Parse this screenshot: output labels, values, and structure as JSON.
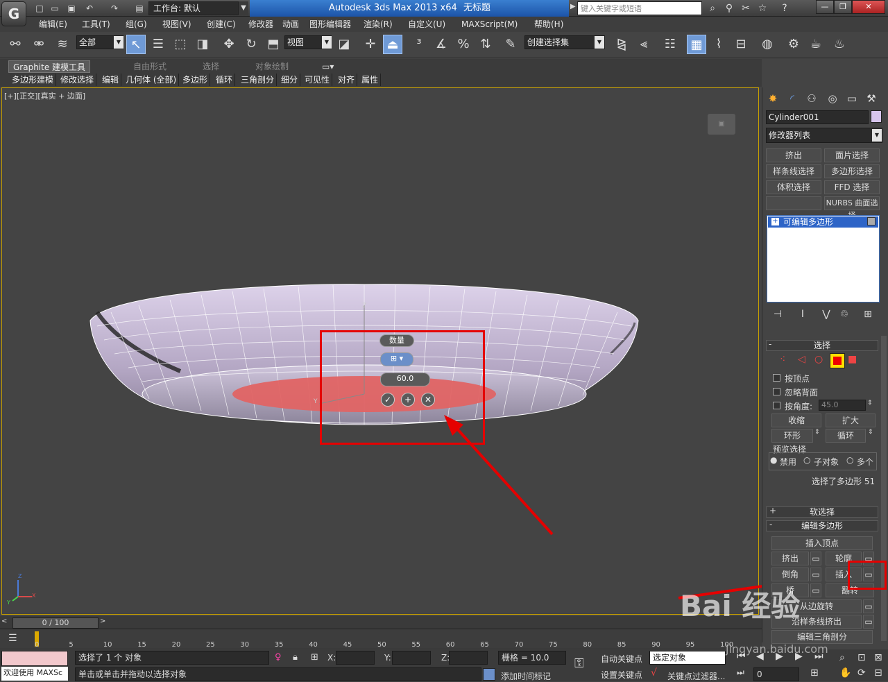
{
  "titlebar": {
    "workspace_label": "工作台: 默认",
    "app_name": "Autodesk 3ds Max  2013 x64",
    "doc_title": "无标题",
    "search_placeholder": "键入关键字或短语"
  },
  "menus": [
    "编辑(E)",
    "工具(T)",
    "组(G)",
    "视图(V)",
    "创建(C)",
    "修改器",
    "动画",
    "图形编辑器",
    "渲染(R)",
    "自定义(U)",
    "MAXScript(M)",
    "帮助(H)"
  ],
  "toolbar": {
    "filter_value": "全部",
    "refcoord_value": "视图",
    "selset_value": "创建选择集"
  },
  "ribbon": {
    "tabs": [
      "Graphite 建模工具",
      "自由形式",
      "选择",
      "对象绘制"
    ],
    "items": [
      "多边形建模",
      "修改选择",
      "编辑",
      "几何体 (全部)",
      "多边形",
      "循环",
      "三角剖分",
      "细分",
      "可见性",
      "对齐",
      "属性"
    ]
  },
  "viewport": {
    "label": "[+][正交][真实 + 边面]",
    "caddy": {
      "title": "数量",
      "value": "60.0"
    },
    "axis": {
      "x": "X",
      "y": "Y",
      "z": "Z"
    }
  },
  "command_panel": {
    "object_name": "Cylinder001",
    "modifier_list": "修改器列表",
    "modifier_buttons": [
      "挤出",
      "面片选择",
      "样条线选择",
      "多边形选择",
      "体积选择",
      "FFD 选择",
      "",
      "NURBS 曲面选择"
    ],
    "stack_item": "可编辑多边形",
    "selection": {
      "title": "选择",
      "by_vertex": "按顶点",
      "ignore_backfacing": "忽略背面",
      "by_angle": "按角度:",
      "angle_value": "45.0",
      "shrink": "收缩",
      "grow": "扩大",
      "ring": "环形",
      "loop": "循环",
      "preview_title": "预览选择",
      "preview_options": [
        "禁用",
        "子对象",
        "多个"
      ],
      "status": "选择了多边形 51"
    },
    "soft_selection": "软选择",
    "edit_polygons": {
      "title": "编辑多边形",
      "insert_vertex": "插入顶点",
      "extrude": "挤出",
      "outline": "轮廓",
      "bevel": "倒角",
      "inset": "插入",
      "bridge": "桥",
      "flip": "翻转",
      "hinge": "从边旋转",
      "extrude_spline": "沿样条线挤出",
      "retriangulate": "编辑三角剖分"
    }
  },
  "timeline": {
    "frame_slider": "0 / 100",
    "ticks": [
      "0",
      "5",
      "10",
      "15",
      "20",
      "25",
      "30",
      "35",
      "40",
      "45",
      "50",
      "55",
      "60",
      "65",
      "70",
      "75",
      "80",
      "85",
      "90",
      "95",
      "100"
    ]
  },
  "statusbar": {
    "script_label": "欢迎使用 MAXSc",
    "selected_status": "选择了 1 个 对象",
    "prompt": "单击或单击并拖动以选择对象",
    "x_label": "X:",
    "y_label": "Y:",
    "z_label": "Z:",
    "grid": "栅格 = 10.0",
    "add_time_tag": "添加时间标记",
    "auto_key": "自动关键点",
    "set_key": "设置关键点",
    "key_mode": "选定对象",
    "key_filters": "关键点过滤器...",
    "frame": "0"
  },
  "watermark": {
    "brand": "Bai 经验",
    "url": "jingyan.baidu.com"
  },
  "colors": {
    "highlight_red": "#e50000",
    "selection_fill": "#e06464",
    "object_color": "#d8c6ee",
    "accent_blue": "#2d64c7"
  }
}
